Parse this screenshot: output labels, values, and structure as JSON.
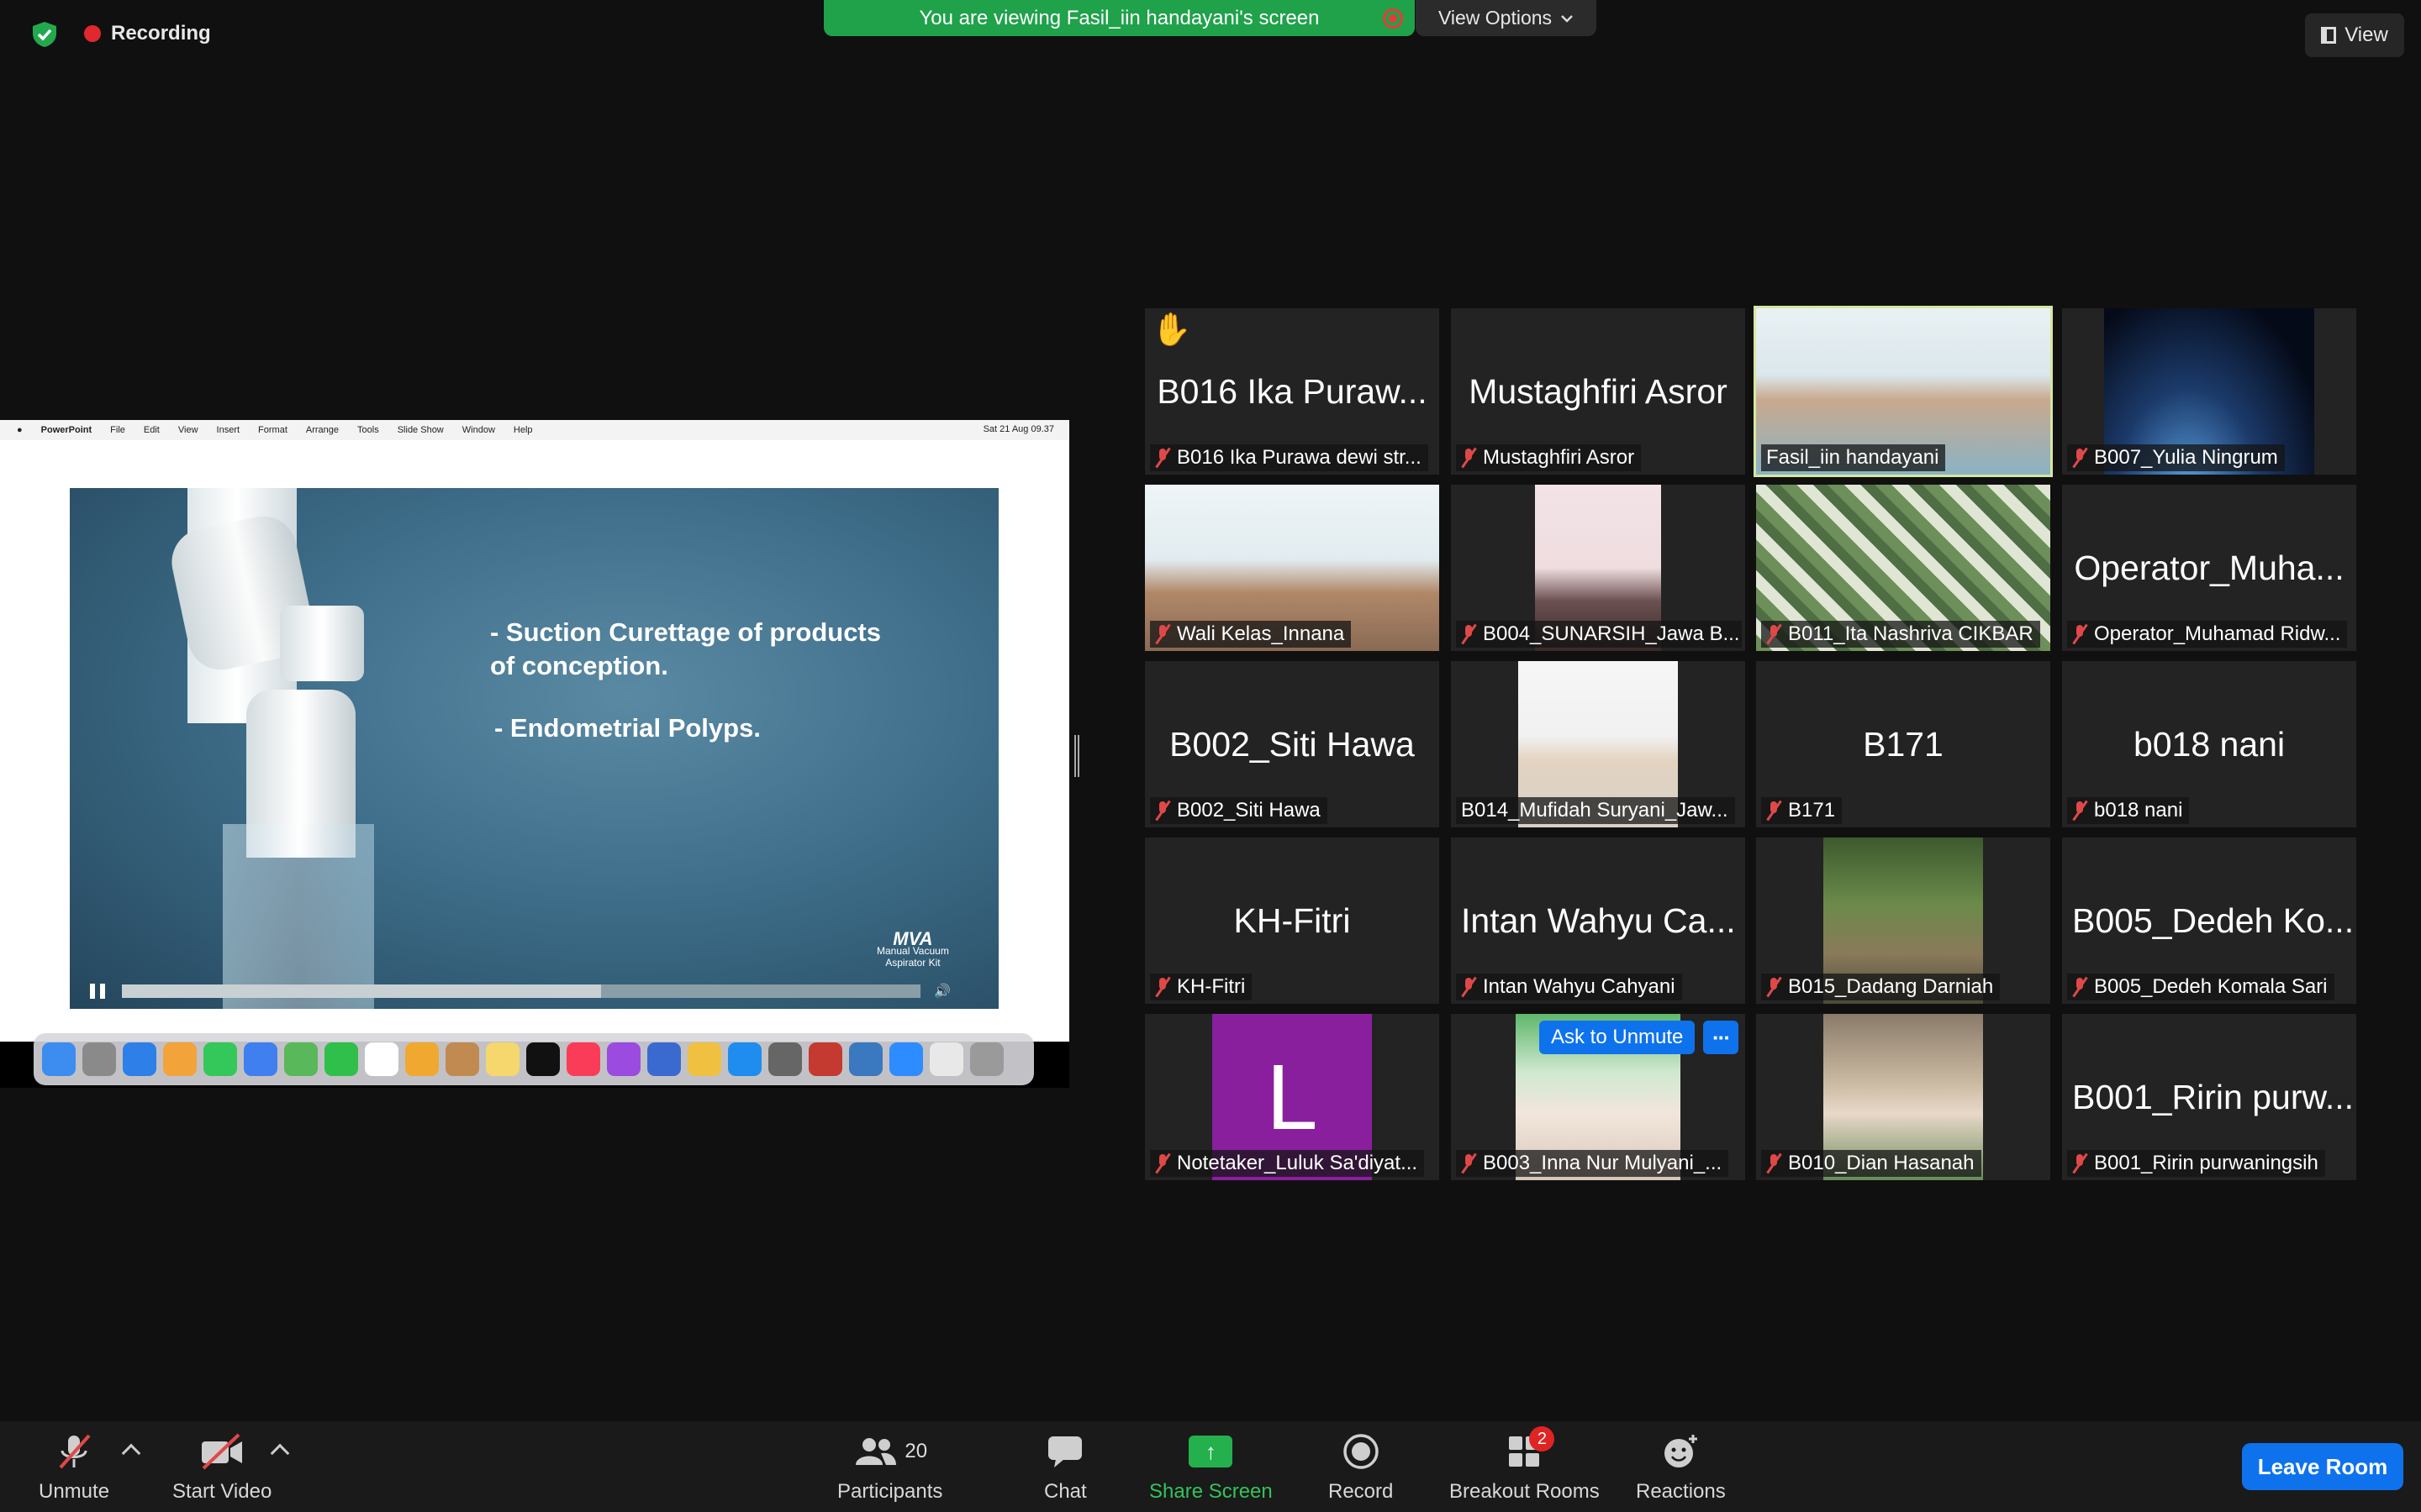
{
  "top": {
    "recording_label": "Recording",
    "viewing_banner": "You are viewing Fasil_iin handayani's screen",
    "view_options_label": "View Options",
    "view_label": "View"
  },
  "shared_screen": {
    "menubar": {
      "app": "PowerPoint",
      "items": [
        "File",
        "Edit",
        "View",
        "Insert",
        "Format",
        "Arrange",
        "Tools",
        "Slide Show",
        "Window",
        "Help"
      ],
      "clock": "Sat 21 Aug 09.37"
    },
    "slide": {
      "line1": "- Suction Curettage of products",
      "line2": "of conception.",
      "line3": "- Endometrial Polyps.",
      "logo_mark": "MVA",
      "logo_text1": "Manual Vacuum",
      "logo_text2": "Aspirator Kit"
    },
    "video_progress": 0.6
  },
  "participants": [
    {
      "big": "B016 Ika Puraw...",
      "tag": "B016 Ika Purawa dewi str...",
      "muted": true,
      "hand": true
    },
    {
      "big": "Mustaghfiri Asror",
      "tag": "Mustaghfiri Asror",
      "muted": true
    },
    {
      "big": "",
      "tag": "Fasil_iin handayani",
      "muted": false,
      "active": true,
      "video": "fasil"
    },
    {
      "big": "",
      "tag": "B007_Yulia Ningrum",
      "muted": true,
      "video": "space"
    },
    {
      "big": "",
      "tag": "Wali Kelas_Innana",
      "muted": true,
      "video": "wali"
    },
    {
      "big": "",
      "tag": "B004_SUNARSIH_Jawa B...",
      "muted": true,
      "video": "sunarsih"
    },
    {
      "big": "",
      "tag": "B011_Ita Nashriva CIKBAR",
      "muted": true,
      "video": "ita"
    },
    {
      "big": "Operator_Muha...",
      "tag": "Operator_Muhamad Ridw...",
      "muted": true
    },
    {
      "big": "B002_Siti Hawa",
      "tag": "B002_Siti Hawa",
      "muted": true
    },
    {
      "big": "",
      "tag": "B014_Mufidah Suryani_Jaw...",
      "muted": false,
      "video": "mufidah"
    },
    {
      "big": "B171",
      "tag": "B171",
      "muted": true
    },
    {
      "big": "b018 nani",
      "tag": "b018 nani",
      "muted": true
    },
    {
      "big": "KH-Fitri",
      "tag": "KH-Fitri",
      "muted": true
    },
    {
      "big": "Intan Wahyu Ca...",
      "tag": "Intan Wahyu Cahyani",
      "muted": true
    },
    {
      "big": "",
      "tag": "B015_Dadang Darniah",
      "muted": true,
      "video": "dadang"
    },
    {
      "big": "B005_Dedeh Ko...",
      "tag": "B005_Dedeh Komala Sari",
      "muted": true
    },
    {
      "big": "",
      "tag": "Notetaker_Luluk Sa'diyat...",
      "muted": true,
      "avatar": "L"
    },
    {
      "big": "",
      "tag": "B003_Inna Nur Mulyani_...",
      "muted": true,
      "video": "inna",
      "ask": "Ask to Unmute",
      "more": "···"
    },
    {
      "big": "",
      "tag": "B010_Dian Hasanah",
      "muted": true,
      "video": "dian"
    },
    {
      "big": "B001_Ririn purw...",
      "tag": "B001_Ririn purwaningsih",
      "muted": true
    }
  ],
  "toolbar": {
    "unmute": "Unmute",
    "start_video": "Start Video",
    "participants": "Participants",
    "participants_count": "20",
    "chat": "Chat",
    "share_screen": "Share Screen",
    "record": "Record",
    "breakout_rooms": "Breakout Rooms",
    "breakout_badge": "2",
    "reactions": "Reactions",
    "leave": "Leave Room"
  },
  "colors": {
    "accent_blue": "#0e72ed",
    "share_green": "#24b04d",
    "banner_green": "#1fa24a",
    "muted_red": "#e04848",
    "active_border": "#d6e7a0"
  }
}
